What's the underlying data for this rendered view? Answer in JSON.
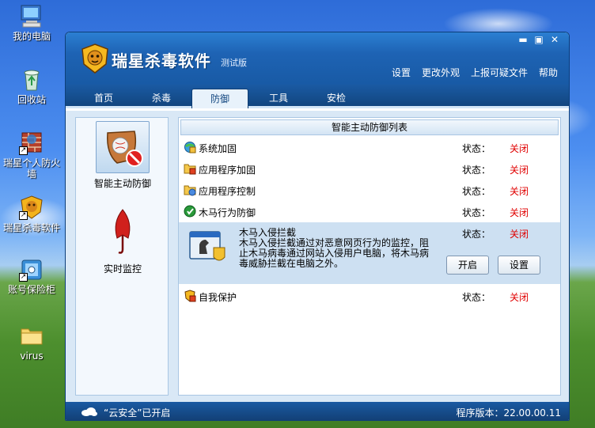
{
  "desktop": {
    "icons": [
      {
        "label": "我的电脑",
        "icon": "my-computer-icon"
      },
      {
        "label": "回收站",
        "icon": "recycle-bin-icon"
      },
      {
        "label": "瑞星个人防火墙",
        "icon": "firewall-icon"
      },
      {
        "label": "瑞星杀毒软件",
        "icon": "rising-antivirus-icon"
      },
      {
        "label": "账号保险柜",
        "icon": "account-safe-icon"
      },
      {
        "label": "virus",
        "icon": "folder-icon"
      }
    ]
  },
  "window": {
    "title": "瑞星杀毒软件",
    "edition": "测试版",
    "controls": {
      "minimize": "▬",
      "maximize": "▣",
      "close": "✕"
    },
    "top_menu": [
      "设置",
      "更改外观",
      "上报可疑文件",
      "帮助"
    ],
    "tabs": [
      "首页",
      "杀毒",
      "防御",
      "工具",
      "安检"
    ],
    "active_tab": "防御"
  },
  "left_panel": {
    "items": [
      {
        "label": "智能主动防御",
        "icon": "active-defense-icon",
        "active": true
      },
      {
        "label": "实时监控",
        "icon": "umbrella-icon",
        "active": false
      }
    ]
  },
  "right_panel": {
    "header": "智能主动防御列表",
    "status_label": "状态：",
    "rows": [
      {
        "name": "系统加固",
        "status": "关闭",
        "icon": "system-harden-icon"
      },
      {
        "name": "应用程序加固",
        "status": "关闭",
        "icon": "app-harden-icon"
      },
      {
        "name": "应用程序控制",
        "status": "关闭",
        "icon": "app-control-icon"
      },
      {
        "name": "木马行为防御",
        "status": "关闭",
        "icon": "trojan-behavior-icon"
      }
    ],
    "expanded_row": {
      "name": "木马入侵拦截",
      "status": "关闭",
      "description": "木马入侵拦截通过对恶意网页行为的监控，阻止木马病毒通过网站入侵用户电脑，将木马病毒威胁拦截在电脑之外。",
      "icon": "trojan-intercept-icon",
      "open_button": "开启",
      "settings_button": "设置"
    },
    "last_row": {
      "name": "自我保护",
      "status": "关闭",
      "icon": "self-protect-icon"
    }
  },
  "status_bar": {
    "cloud_text": "“云安全”已开启",
    "version_label": "程序版本：",
    "version": "22.00.00.11"
  },
  "colors": {
    "accent": "#1e63b4",
    "status_off": "#e00000"
  }
}
